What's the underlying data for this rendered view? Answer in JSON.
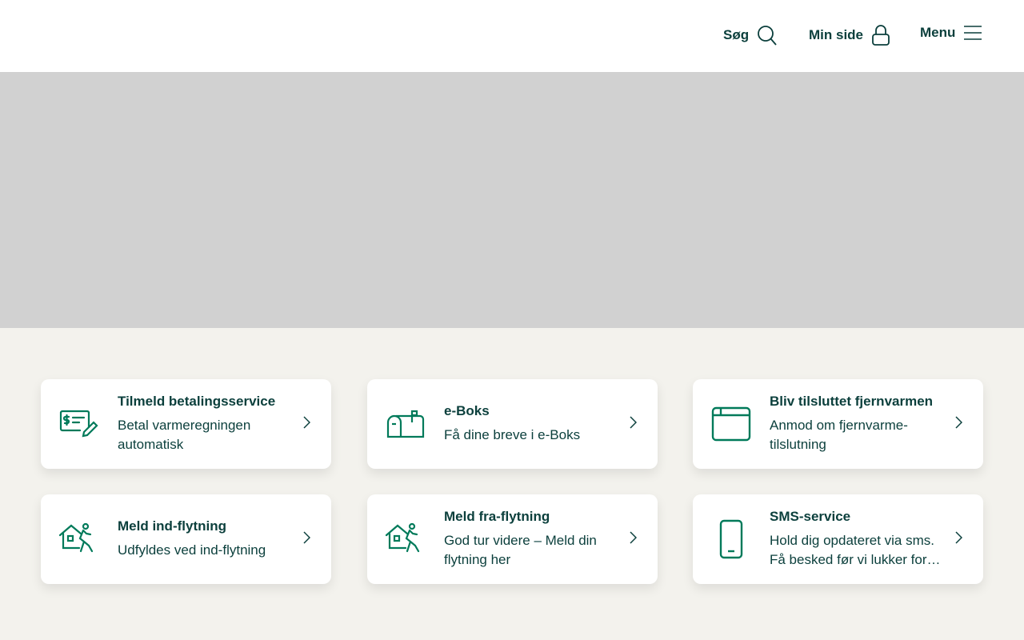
{
  "header": {
    "search_label": "Søg",
    "mypage_label": "Min side",
    "menu_label": "Menu"
  },
  "colors": {
    "text": "#0b3f3c",
    "icon": "#007a5a",
    "background": "#f3f2ed",
    "hero": "#d1d1d1"
  },
  "cards": [
    {
      "title": "Tilmeld betalingsservice",
      "desc": "Betal varmeregningen automatisk",
      "icon": "payment-check-icon"
    },
    {
      "title": "e-Boks",
      "desc": "Få dine breve i e-Boks",
      "icon": "mailbox-icon"
    },
    {
      "title": "Bliv tilsluttet fjernvarmen",
      "desc": "Anmod om fjernvarme-tilslutning",
      "icon": "browser-window-icon"
    },
    {
      "title": "Meld ind-flytning",
      "desc": "Udfyldes ved ind-flytning",
      "icon": "house-moving-icon"
    },
    {
      "title": "Meld fra-flytning",
      "desc": "God tur videre – Meld din flytning her",
      "icon": "house-moving-icon"
    },
    {
      "title": "SMS-service",
      "desc": "Hold dig opdateret via sms. Få besked før vi lukker for…",
      "icon": "mobile-phone-icon"
    }
  ]
}
